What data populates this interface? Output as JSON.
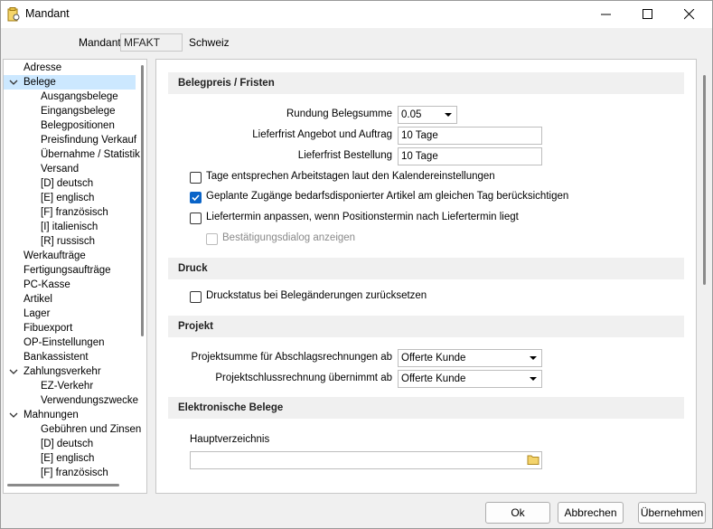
{
  "window": {
    "title": "Mandant"
  },
  "header": {
    "mandant_label": "Mandant",
    "mandant_code": "MFAKT",
    "mandant_name": "Schweiz"
  },
  "tree": {
    "items": [
      {
        "label": "Adresse",
        "level": 0,
        "selected": false
      },
      {
        "label": "Belege",
        "level": 0,
        "selected": true,
        "expanded": true
      },
      {
        "label": "Ausgangsbelege",
        "level": 1
      },
      {
        "label": "Eingangsbelege",
        "level": 1
      },
      {
        "label": "Belegpositionen",
        "level": 1
      },
      {
        "label": "Preisfindung Verkauf",
        "level": 1
      },
      {
        "label": "Übernahme / Statistik",
        "level": 1
      },
      {
        "label": "Versand",
        "level": 1
      },
      {
        "label": "[D] deutsch",
        "level": 1
      },
      {
        "label": "[E] englisch",
        "level": 1
      },
      {
        "label": "[F] französisch",
        "level": 1
      },
      {
        "label": "[I] italienisch",
        "level": 1
      },
      {
        "label": "[R] russisch",
        "level": 1
      },
      {
        "label": "Werkaufträge",
        "level": 0
      },
      {
        "label": "Fertigungsaufträge",
        "level": 0
      },
      {
        "label": "PC-Kasse",
        "level": 0
      },
      {
        "label": "Artikel",
        "level": 0
      },
      {
        "label": "Lager",
        "level": 0
      },
      {
        "label": "Fibuexport",
        "level": 0
      },
      {
        "label": "OP-Einstellungen",
        "level": 0
      },
      {
        "label": "Bankassistent",
        "level": 0
      },
      {
        "label": "Zahlungsverkehr",
        "level": 0,
        "expanded": true
      },
      {
        "label": "EZ-Verkehr",
        "level": 1
      },
      {
        "label": "Verwendungszwecke",
        "level": 1
      },
      {
        "label": "Mahnungen",
        "level": 0,
        "expanded": true
      },
      {
        "label": "Gebühren und Zinsen",
        "level": 1
      },
      {
        "label": "[D] deutsch",
        "level": 1
      },
      {
        "label": "[E] englisch",
        "level": 1
      },
      {
        "label": "[F] französisch",
        "level": 1
      }
    ]
  },
  "sections": {
    "belegpreis": {
      "title": "Belegpreis / Fristen",
      "rundung_label": "Rundung Belegsumme",
      "rundung_value": "0.05",
      "lieferfrist_angebot_label": "Lieferfrist Angebot und Auftrag",
      "lieferfrist_angebot_value": "10 Tage",
      "lieferfrist_bestellung_label": "Lieferfrist Bestellung",
      "lieferfrist_bestellung_value": "10 Tage",
      "cb_arbeitstage": {
        "label": "Tage entsprechen Arbeitstagen laut den Kalendereinstellungen",
        "checked": false
      },
      "cb_geplante": {
        "label": "Geplante Zugänge bedarfsdisponierter Artikel am gleichen Tag berücksichtigen",
        "checked": true
      },
      "cb_liefertermin": {
        "label": "Liefertermin anpassen, wenn Positionstermin nach Liefertermin liegt",
        "checked": false
      },
      "cb_bestaetigung": {
        "label": "Bestätigungsdialog anzeigen",
        "checked": false,
        "disabled": true
      }
    },
    "druck": {
      "title": "Druck",
      "cb_druckstatus": {
        "label": "Druckstatus bei Belegänderungen zurücksetzen",
        "checked": false
      }
    },
    "projekt": {
      "title": "Projekt",
      "summe_label": "Projektsumme für Abschlagsrechnungen ab",
      "summe_value": "Offerte Kunde",
      "schluss_label": "Projektschlussrechnung übernimmt ab",
      "schluss_value": "Offerte Kunde"
    },
    "elektronisch": {
      "title": "Elektronische Belege",
      "hauptverzeichnis_label": "Hauptverzeichnis",
      "hauptverzeichnis_value": ""
    }
  },
  "buttons": {
    "ok": "Ok",
    "abbrechen": "Abbrechen",
    "uebernehmen": "Übernehmen"
  },
  "colors": {
    "checkbox_checked": "#0a64c8",
    "selection": "#cce8ff",
    "section_bg": "#f0f0f0"
  }
}
